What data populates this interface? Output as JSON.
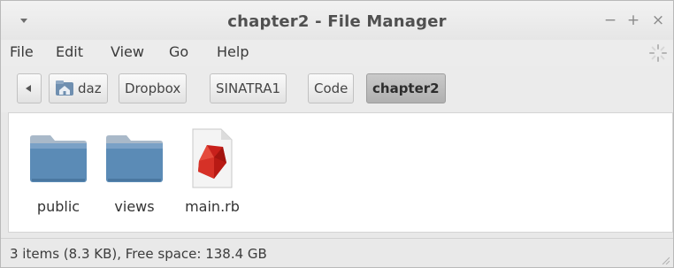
{
  "window": {
    "title": "chapter2 - File Manager",
    "controls": {
      "minimize": "−",
      "maximize": "+",
      "close": "×"
    }
  },
  "menu": {
    "items": [
      "File",
      "Edit",
      "View",
      "Go",
      "Help"
    ]
  },
  "path": {
    "crumbs": [
      {
        "label": "daz",
        "icon": "home-folder-icon",
        "active": false
      },
      {
        "label": "Dropbox",
        "active": false
      },
      {
        "label": "SINATRA1",
        "active": false
      },
      {
        "label": "Code",
        "active": false
      },
      {
        "label": "chapter2",
        "active": true
      }
    ]
  },
  "files": [
    {
      "name": "public",
      "icon": "folder-icon"
    },
    {
      "name": "views",
      "icon": "folder-icon"
    },
    {
      "name": "main.rb",
      "icon": "ruby-file-icon"
    }
  ],
  "status": {
    "text": "3 items (8.3 KB), Free space: 138.4 GB"
  },
  "colors": {
    "folder_top": "#9fb3c8",
    "folder_body": "#5d8db8",
    "ruby_red": "#c8201b",
    "active_crumb": "#b8b8b8"
  }
}
